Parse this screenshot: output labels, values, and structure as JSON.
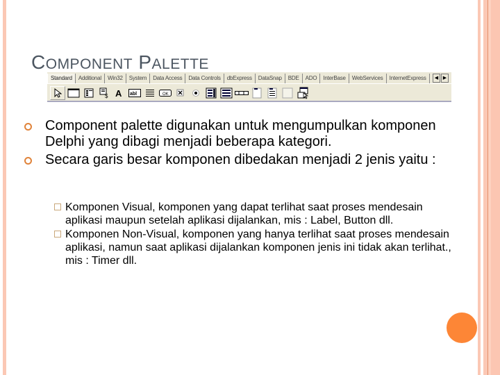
{
  "slide": {
    "title_parts": [
      {
        "cap": "C",
        "rest": "OMPONENT"
      },
      {
        "cap": "P",
        "rest": "ALETTE"
      }
    ],
    "accent_color": "#fd8636",
    "stripe_color": "#fbc8b5"
  },
  "palette": {
    "tabs": [
      "Standard",
      "Additional",
      "Win32",
      "System",
      "Data Access",
      "Data Controls",
      "dbExpress",
      "DataSnap",
      "BDE",
      "ADO",
      "InterBase",
      "WebServices",
      "InternetExpress"
    ],
    "active_tab": "Standard",
    "scroll_left": "◀",
    "scroll_right": "▶",
    "components": [
      {
        "name": "pointer-icon",
        "label": "Pointer"
      },
      {
        "name": "frame-icon",
        "label": "Frames"
      },
      {
        "name": "mainmenu-icon",
        "label": "MainMenu"
      },
      {
        "name": "popupmenu-icon",
        "label": "PopupMenu"
      },
      {
        "name": "label-icon",
        "label": "Label"
      },
      {
        "name": "edit-icon",
        "label": "Edit"
      },
      {
        "name": "memo-icon",
        "label": "Memo"
      },
      {
        "name": "button-icon",
        "label": "Button"
      },
      {
        "name": "checkbox-icon",
        "label": "CheckBox"
      },
      {
        "name": "radiobutton-icon",
        "label": "RadioButton"
      },
      {
        "name": "listbox-icon",
        "label": "ListBox"
      },
      {
        "name": "combobox-icon",
        "label": "ComboBox"
      },
      {
        "name": "scrollbar-icon",
        "label": "ScrollBar"
      },
      {
        "name": "groupbox-icon",
        "label": "GroupBox"
      },
      {
        "name": "radiogroup-icon",
        "label": "RadioGroup"
      },
      {
        "name": "panel-icon",
        "label": "Panel"
      },
      {
        "name": "actionlist-icon",
        "label": "ActionList"
      }
    ]
  },
  "bullets": [
    {
      "text": "Component palette digunakan untuk mengumpulkan komponen Delphi yang dibagi menjadi beberapa kategori."
    },
    {
      "text": "Secara garis besar komponen dibedakan menjadi 2 jenis yaitu :"
    }
  ],
  "sub_bullets": [
    {
      "text": "Komponen Visual, komponen yang dapat terlihat saat proses mendesain aplikasi maupun setelah aplikasi dijalankan, mis : Label, Button dll."
    },
    {
      "text": "Komponen Non-Visual, komponen yang hanya terlihat saat proses mendesain aplikasi, namun saat aplikasi dijalankan komponen jenis ini tidak akan terlihat., mis : Timer dll."
    }
  ]
}
